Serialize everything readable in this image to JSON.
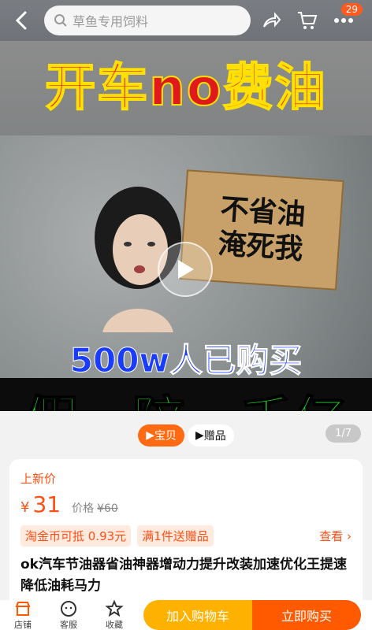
{
  "top_bar": {
    "search_placeholder": "草鱼专用饲料",
    "badge_count": "29"
  },
  "media": {
    "headline": "开车no费油",
    "sign_line1": "不省油",
    "sign_line2": "淹死我",
    "buyers": "500w人已购买",
    "guarantee": "假一陪一千亿",
    "tab_active": "宝贝",
    "tab_gift": "赠品",
    "counter": "1/7"
  },
  "price_card": {
    "new_tag": "上新价",
    "yen": "¥",
    "price": "31",
    "orig_label": "价格",
    "orig_price": "¥60",
    "promo1": "淘金币可抵 0.93元",
    "promo2": "满1件送赠品",
    "view": "查看",
    "title": "ok汽车节油器省油神器增动力提升改装加速优化王提速降低油耗马力"
  },
  "bottom_bar": {
    "shop": "店铺",
    "service": "客服",
    "favorite": "收藏",
    "cart": "加入购物车",
    "buy": "立即购买"
  }
}
